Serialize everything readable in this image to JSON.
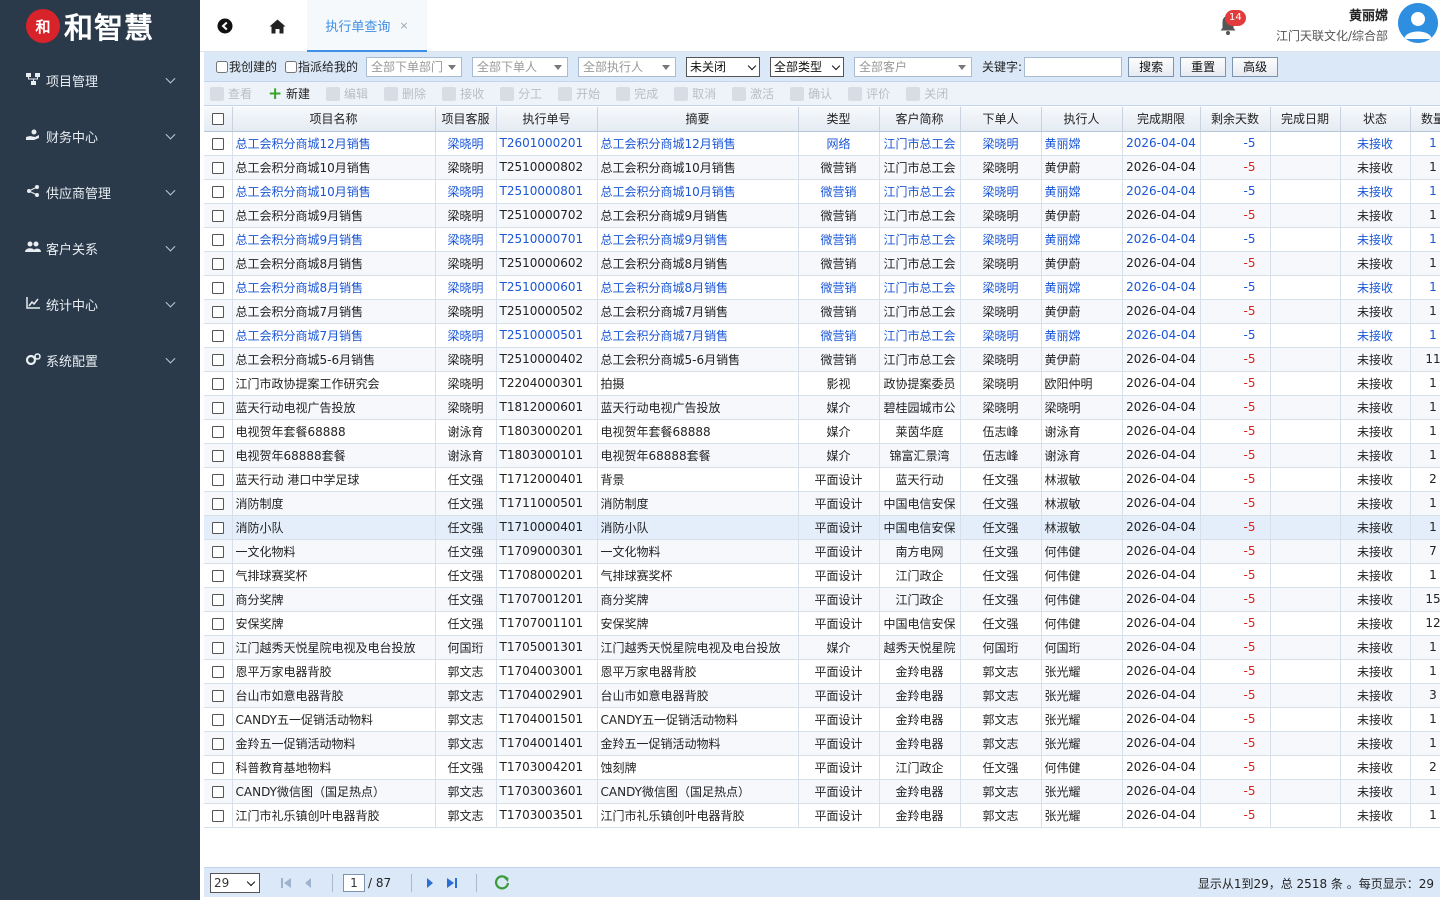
{
  "brand": {
    "mark": "和",
    "name": "和智慧"
  },
  "sidebar": {
    "items": [
      {
        "label": "项目管理",
        "icon": "sitemap-icon"
      },
      {
        "label": "财务中心",
        "icon": "hand-coin-icon"
      },
      {
        "label": "供应商管理",
        "icon": "share-icon"
      },
      {
        "label": "客户关系",
        "icon": "users-icon"
      },
      {
        "label": "统计中心",
        "icon": "chart-line-icon"
      },
      {
        "label": "系统配置",
        "icon": "gears-icon"
      }
    ]
  },
  "topbar": {
    "active_tab": "执行单查询",
    "tab_close": "×",
    "notification_count": "14",
    "user_name": "黄丽嫦",
    "user_org": "江门天联文化/综合部"
  },
  "filters": {
    "my_created": "我创建的",
    "assigned_to_me": "指派给我的",
    "dept_placeholder": "全部下单部门",
    "orderer_placeholder": "全部下单人",
    "executor_placeholder": "全部执行人",
    "close_status": "未关闭",
    "type": "全部类型",
    "customer_placeholder": "全部客户",
    "keyword_label": "关键字:",
    "keyword_value": "",
    "search_label": "搜索",
    "reset_label": "重置",
    "advanced_label": "高级"
  },
  "toolbar": [
    "查看",
    "新建",
    "编辑",
    "删除",
    "接收",
    "分工",
    "开始",
    "完成",
    "取消",
    "激活",
    "确认",
    "评价",
    "关闭"
  ],
  "table": {
    "columns": [
      "项目名称",
      "项目客服",
      "执行单号",
      "摘要",
      "类型",
      "客户简称",
      "下单人",
      "执行人",
      "完成期限",
      "剩余天数",
      "完成日期",
      "状态",
      "数量"
    ],
    "rows": [
      [
        "总工会积分商城12月销售",
        "梁晓明",
        "T2601000201",
        "总工会积分商城12月销售",
        "网络",
        "江门市总工会",
        "梁晓明",
        "黄丽嫦",
        "2026-04-04",
        "-5",
        "",
        "未接收",
        "1"
      ],
      [
        "总工会积分商城10月销售",
        "梁晓明",
        "T2510000802",
        "总工会积分商城10月销售",
        "微营销",
        "江门市总工会",
        "梁晓明",
        "黄伊蔚",
        "2026-04-04",
        "-5",
        "",
        "未接收",
        "1"
      ],
      [
        "总工会积分商城10月销售",
        "梁晓明",
        "T2510000801",
        "总工会积分商城10月销售",
        "微营销",
        "江门市总工会",
        "梁晓明",
        "黄丽嫦",
        "2026-04-04",
        "-5",
        "",
        "未接收",
        "1"
      ],
      [
        "总工会积分商城9月销售",
        "梁晓明",
        "T2510000702",
        "总工会积分商城9月销售",
        "微营销",
        "江门市总工会",
        "梁晓明",
        "黄伊蔚",
        "2026-04-04",
        "-5",
        "",
        "未接收",
        "1"
      ],
      [
        "总工会积分商城9月销售",
        "梁晓明",
        "T2510000701",
        "总工会积分商城9月销售",
        "微营销",
        "江门市总工会",
        "梁晓明",
        "黄丽嫦",
        "2026-04-04",
        "-5",
        "",
        "未接收",
        "1"
      ],
      [
        "总工会积分商城8月销售",
        "梁晓明",
        "T2510000602",
        "总工会积分商城8月销售",
        "微营销",
        "江门市总工会",
        "梁晓明",
        "黄伊蔚",
        "2026-04-04",
        "-5",
        "",
        "未接收",
        "1"
      ],
      [
        "总工会积分商城8月销售",
        "梁晓明",
        "T2510000601",
        "总工会积分商城8月销售",
        "微营销",
        "江门市总工会",
        "梁晓明",
        "黄丽嫦",
        "2026-04-04",
        "-5",
        "",
        "未接收",
        "1"
      ],
      [
        "总工会积分商城7月销售",
        "梁晓明",
        "T2510000502",
        "总工会积分商城7月销售",
        "微营销",
        "江门市总工会",
        "梁晓明",
        "黄伊蔚",
        "2026-04-04",
        "-5",
        "",
        "未接收",
        "1"
      ],
      [
        "总工会积分商城7月销售",
        "梁晓明",
        "T2510000501",
        "总工会积分商城7月销售",
        "微营销",
        "江门市总工会",
        "梁晓明",
        "黄丽嫦",
        "2026-04-04",
        "-5",
        "",
        "未接收",
        "1"
      ],
      [
        "总工会积分商城5-6月销售",
        "梁晓明",
        "T2510000402",
        "总工会积分商城5-6月销售",
        "微营销",
        "江门市总工会",
        "梁晓明",
        "黄伊蔚",
        "2026-04-04",
        "-5",
        "",
        "未接收",
        "11"
      ],
      [
        "江门市政协提案工作研究会",
        "梁晓明",
        "T2204000301",
        "拍摄",
        "影视",
        "政协提案委员",
        "梁晓明",
        "欧阳仲明",
        "2026-04-04",
        "-5",
        "",
        "未接收",
        "1"
      ],
      [
        "蓝天行动电视广告投放",
        "梁晓明",
        "T1812000601",
        "蓝天行动电视广告投放",
        "媒介",
        "碧桂园城市公",
        "梁晓明",
        "梁晓明",
        "2026-04-04",
        "-5",
        "",
        "未接收",
        "1"
      ],
      [
        "电视贺年套餐68888",
        "谢泳育",
        "T1803000201",
        "电视贺年套餐68888",
        "媒介",
        "莱茵华庭",
        "伍志峰",
        "谢泳育",
        "2026-04-04",
        "-5",
        "",
        "未接收",
        "1"
      ],
      [
        "电视贺年68888套餐",
        "谢泳育",
        "T1803000101",
        "电视贺年68888套餐",
        "媒介",
        "锦富汇景湾",
        "伍志峰",
        "谢泳育",
        "2026-04-04",
        "-5",
        "",
        "未接收",
        "1"
      ],
      [
        "蓝天行动 港口中学足球",
        "任文强",
        "T1712000401",
        "背景",
        "平面设计",
        "蓝天行动",
        "任文强",
        "林淑敏",
        "2026-04-04",
        "-5",
        "",
        "未接收",
        "2"
      ],
      [
        "消防制度",
        "任文强",
        "T1711000501",
        "消防制度",
        "平面设计",
        "中国电信安保",
        "任文强",
        "林淑敏",
        "2026-04-04",
        "-5",
        "",
        "未接收",
        "1"
      ],
      [
        "消防小队",
        "任文强",
        "T1710000401",
        "消防小队",
        "平面设计",
        "中国电信安保",
        "任文强",
        "林淑敏",
        "2026-04-04",
        "-5",
        "",
        "未接收",
        "1"
      ],
      [
        "一文化物料",
        "任文强",
        "T1709000301",
        "一文化物料",
        "平面设计",
        "南方电网",
        "任文强",
        "何伟健",
        "2026-04-04",
        "-5",
        "",
        "未接收",
        "7"
      ],
      [
        "气排球赛奖杯",
        "任文强",
        "T1708000201",
        "气排球赛奖杯",
        "平面设计",
        "江门政企",
        "任文强",
        "何伟健",
        "2026-04-04",
        "-5",
        "",
        "未接收",
        "1"
      ],
      [
        "商分奖牌",
        "任文强",
        "T1707001201",
        "商分奖牌",
        "平面设计",
        "江门政企",
        "任文强",
        "何伟健",
        "2026-04-04",
        "-5",
        "",
        "未接收",
        "15"
      ],
      [
        "安保奖牌",
        "任文强",
        "T1707001101",
        "安保奖牌",
        "平面设计",
        "中国电信安保",
        "任文强",
        "何伟健",
        "2026-04-04",
        "-5",
        "",
        "未接收",
        "12"
      ],
      [
        "江门越秀天悦星院电视及电台投放",
        "何国珩",
        "T1705001301",
        "江门越秀天悦星院电视及电台投放",
        "媒介",
        "越秀天悦星院",
        "何国珩",
        "何国珩",
        "2026-04-04",
        "-5",
        "",
        "未接收",
        "1"
      ],
      [
        "恩平万家电器背胶",
        "郭文志",
        "T1704003001",
        "恩平万家电器背胶",
        "平面设计",
        "金羚电器",
        "郭文志",
        "张光耀",
        "2026-04-04",
        "-5",
        "",
        "未接收",
        "1"
      ],
      [
        "台山市如意电器背胶",
        "郭文志",
        "T1704002901",
        "台山市如意电器背胶",
        "平面设计",
        "金羚电器",
        "郭文志",
        "张光耀",
        "2026-04-04",
        "-5",
        "",
        "未接收",
        "3"
      ],
      [
        "CANDY五一促销活动物料",
        "郭文志",
        "T1704001501",
        "CANDY五一促销活动物料",
        "平面设计",
        "金羚电器",
        "郭文志",
        "张光耀",
        "2026-04-04",
        "-5",
        "",
        "未接收",
        "1"
      ],
      [
        "金羚五一促销活动物料",
        "郭文志",
        "T1704001401",
        "金羚五一促销活动物料",
        "平面设计",
        "金羚电器",
        "郭文志",
        "张光耀",
        "2026-04-04",
        "-5",
        "",
        "未接收",
        "1"
      ],
      [
        "科普教育基地物料",
        "任文强",
        "T1703004201",
        "蚀刻牌",
        "平面设计",
        "江门政企",
        "任文强",
        "何伟健",
        "2026-04-04",
        "-5",
        "",
        "未接收",
        "2"
      ],
      [
        "CANDY微信图（国足热点）",
        "郭文志",
        "T1703003601",
        "CANDY微信图（国足热点）",
        "平面设计",
        "金羚电器",
        "郭文志",
        "张光耀",
        "2026-04-04",
        "-5",
        "",
        "未接收",
        "1"
      ],
      [
        "江门市礼乐镇创叶电器背胶",
        "郭文志",
        "T1703003501",
        "江门市礼乐镇创叶电器背胶",
        "平面设计",
        "金羚电器",
        "郭文志",
        "张光耀",
        "2026-04-04",
        "-5",
        "",
        "未接收",
        "1"
      ]
    ]
  },
  "pager": {
    "page_size": "29",
    "current_page": "1",
    "total_pages": "/ 87",
    "info": "显示从1到29，总 2518 条 。每页显示：29"
  }
}
